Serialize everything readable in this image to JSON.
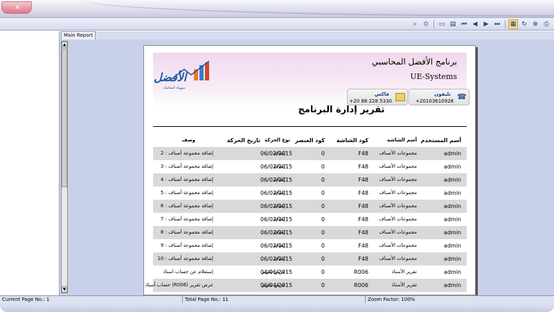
{
  "tab": {
    "label": "Main Report"
  },
  "company": {
    "name_ar": "برنامج الأفضل المحاسبي",
    "name_en": "UE-Systems",
    "logo_text": "الأفضل",
    "logo_sub": "سهولة المعامله",
    "phone_label": "تليفون",
    "phone_value": "+20103610928",
    "fax_label": "فاكس",
    "fax_value": "+20 88 228 5330"
  },
  "report": {
    "title": "تقرير إدارة البرنامج",
    "columns": {
      "user": "أسم المستخدم",
      "screen": "أسم الشاشة",
      "screen_code": "كود الشاشة",
      "item_code": "كود العنصر",
      "move_type": "نوع الحركة",
      "date": "تاريخ الحركة",
      "desc": "وصف"
    },
    "rows": [
      {
        "user": "admin",
        "screen": "مجموعات الأصناف",
        "screen_code": "F48",
        "item_code": "0",
        "move_type": "إضافة",
        "date": "06/02/2015",
        "desc": "إضافة مجموعة أصناف : 2"
      },
      {
        "user": "admin",
        "screen": "مجموعات الأصناف",
        "screen_code": "F48",
        "item_code": "0",
        "move_type": "إضافة",
        "date": "06/02/2015",
        "desc": "إضافة مجموعة أصناف : 3"
      },
      {
        "user": "admin",
        "screen": "مجموعات الأصناف",
        "screen_code": "F48",
        "item_code": "0",
        "move_type": "إضافة",
        "date": "06/02/2015",
        "desc": "إضافة مجموعة أصناف : 4"
      },
      {
        "user": "admin",
        "screen": "مجموعات الأصناف",
        "screen_code": "F48",
        "item_code": "0",
        "move_type": "إضافة",
        "date": "06/02/2015",
        "desc": "إضافة مجموعة أصناف : 5"
      },
      {
        "user": "admin",
        "screen": "مجموعات الأصناف",
        "screen_code": "F48",
        "item_code": "0",
        "move_type": "إضافة",
        "date": "06/02/2015",
        "desc": "إضافة مجموعة أصناف : 6"
      },
      {
        "user": "admin",
        "screen": "مجموعات الأصناف",
        "screen_code": "F48",
        "item_code": "0",
        "move_type": "إضافة",
        "date": "06/02/2015",
        "desc": "إضافة مجموعة أصناف : 7"
      },
      {
        "user": "admin",
        "screen": "مجموعات الأصناف",
        "screen_code": "F48",
        "item_code": "0",
        "move_type": "إضافة",
        "date": "06/02/2015",
        "desc": "إضافة مجموعة أصناف : 8"
      },
      {
        "user": "admin",
        "screen": "مجموعات الأصناف",
        "screen_code": "F48",
        "item_code": "0",
        "move_type": "إضافة",
        "date": "06/02/2015",
        "desc": "إضافة مجموعة أصناف : 9"
      },
      {
        "user": "admin",
        "screen": "مجموعات الأصناف",
        "screen_code": "F48",
        "item_code": "0",
        "move_type": "إضافة",
        "date": "06/02/2015",
        "desc": "إضافة مجموعة أصناف : 10"
      },
      {
        "user": "admin",
        "screen": "تقرير الأستاذ",
        "screen_code": "R006",
        "item_code": "0",
        "move_type": "عرض تقرير",
        "date": "04/06/2015",
        "desc": "إستعلام عن حساب استاذ"
      },
      {
        "user": "admin",
        "screen": "تقرير الأستاذ",
        "screen_code": "R006",
        "item_code": "0",
        "move_type": "عرض تقرير",
        "date": "06/04/2015",
        "desc": "حساب أستاذ (R006) عرض تقرير"
      }
    ]
  },
  "status": {
    "current_page": "Current Page No.: 1",
    "total_page": "Total Page No.: 11",
    "zoom": "Zoom Factor: 100%"
  },
  "icons": {
    "close": "close-icon",
    "toolbar": [
      "find-icon",
      "binoculars-icon",
      "copy-icon",
      "export-icon",
      "first-page-icon",
      "prev-page-icon",
      "next-page-icon",
      "last-page-icon",
      "tree-icon",
      "refresh-icon",
      "zoom-icon",
      "print-icon"
    ]
  }
}
